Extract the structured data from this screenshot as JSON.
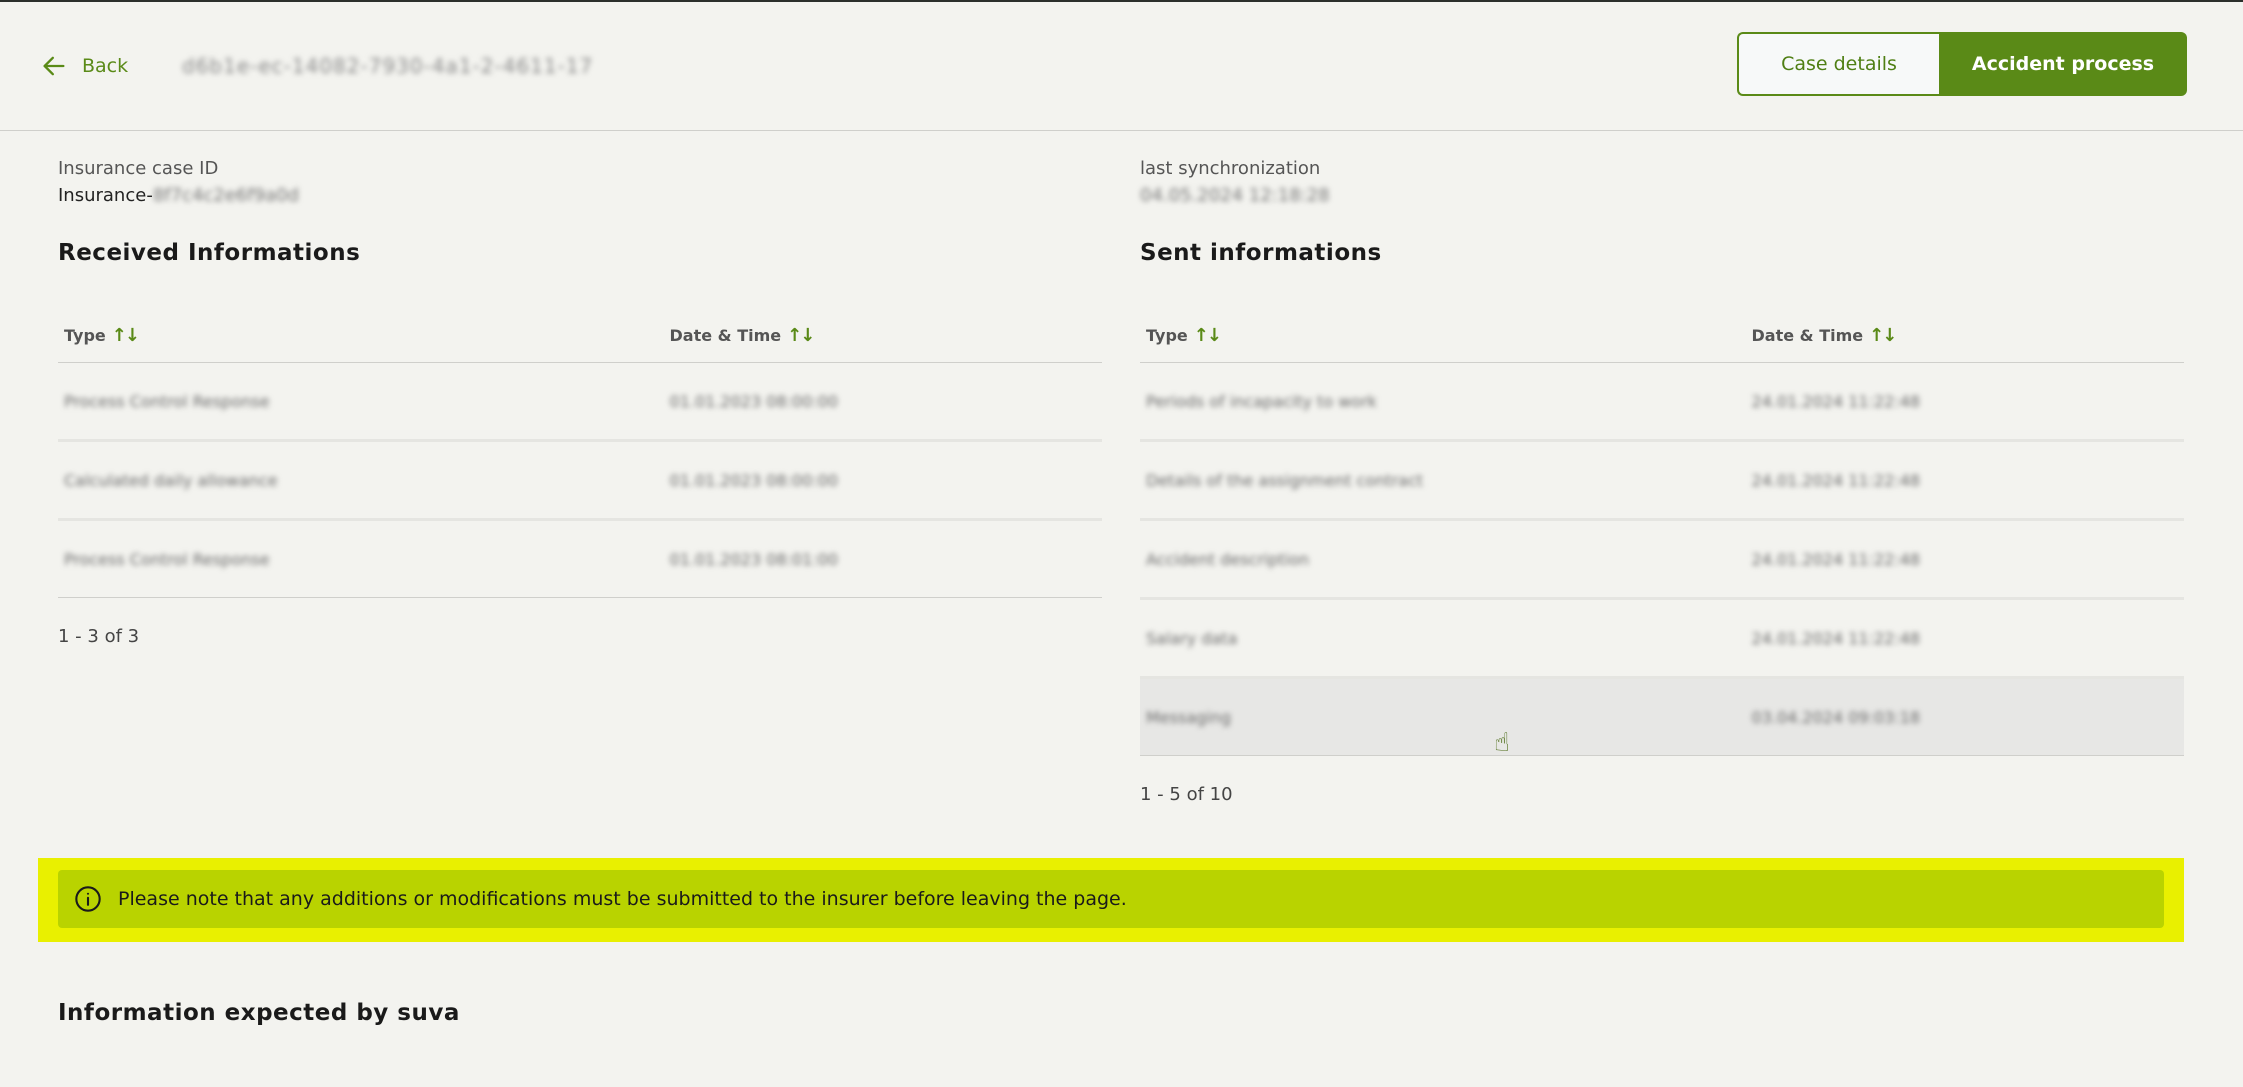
{
  "header": {
    "back_label": "Back",
    "case_title": "d6b1e-ec-14082-7930-4a1-2-4611-17",
    "case_details_label": "Case details",
    "accident_process_label": "Accident process"
  },
  "received": {
    "meta_label": "Insurance case ID",
    "meta_prefix": "Insurance-",
    "meta_value_blurred": "8f7c4c2e6f9a0d",
    "title": "Received Informations",
    "col_type": "Type",
    "col_datetime": "Date & Time",
    "rows": [
      {
        "type": "Process Control Response",
        "datetime": "01.01.2023 08:00:00"
      },
      {
        "type": "Calculated daily allowance",
        "datetime": "01.01.2023 08:00:00"
      },
      {
        "type": "Process Control Response",
        "datetime": "01.01.2023 08:01:00"
      }
    ],
    "pagination": "1 - 3 of 3"
  },
  "sent": {
    "meta_label": "last synchronization",
    "meta_value_blurred": "04.05.2024 12:18:28",
    "title": "Sent informations",
    "col_type": "Type",
    "col_datetime": "Date & Time",
    "rows": [
      {
        "type": "Periods of incapacity to work",
        "datetime": "24.01.2024 11:22:48"
      },
      {
        "type": "Details of the assignment contract",
        "datetime": "24.01.2024 11:22:48"
      },
      {
        "type": "Accident description",
        "datetime": "24.01.2024 11:22:48"
      },
      {
        "type": "Salary data",
        "datetime": "24.01.2024 11:22:48"
      },
      {
        "type": "Messaging",
        "datetime": "03.04.2024 09:03:18"
      }
    ],
    "pagination": "1 - 5 of 10"
  },
  "notice": {
    "text": "Please note that any additions or modifications must be submitted to the insurer before leaving the page."
  },
  "expected": {
    "title": "Information expected by suva"
  },
  "icons": {
    "back": "arrow-left-icon",
    "sort": "sort-arrows-icon",
    "info": "info-circle-icon",
    "cursor": "hand-pointer-icon"
  },
  "colors": {
    "accent": "#5a8a17",
    "notice_outer": "#e9f000",
    "notice_inner": "#b9d300",
    "background": "#f3f3ef"
  }
}
